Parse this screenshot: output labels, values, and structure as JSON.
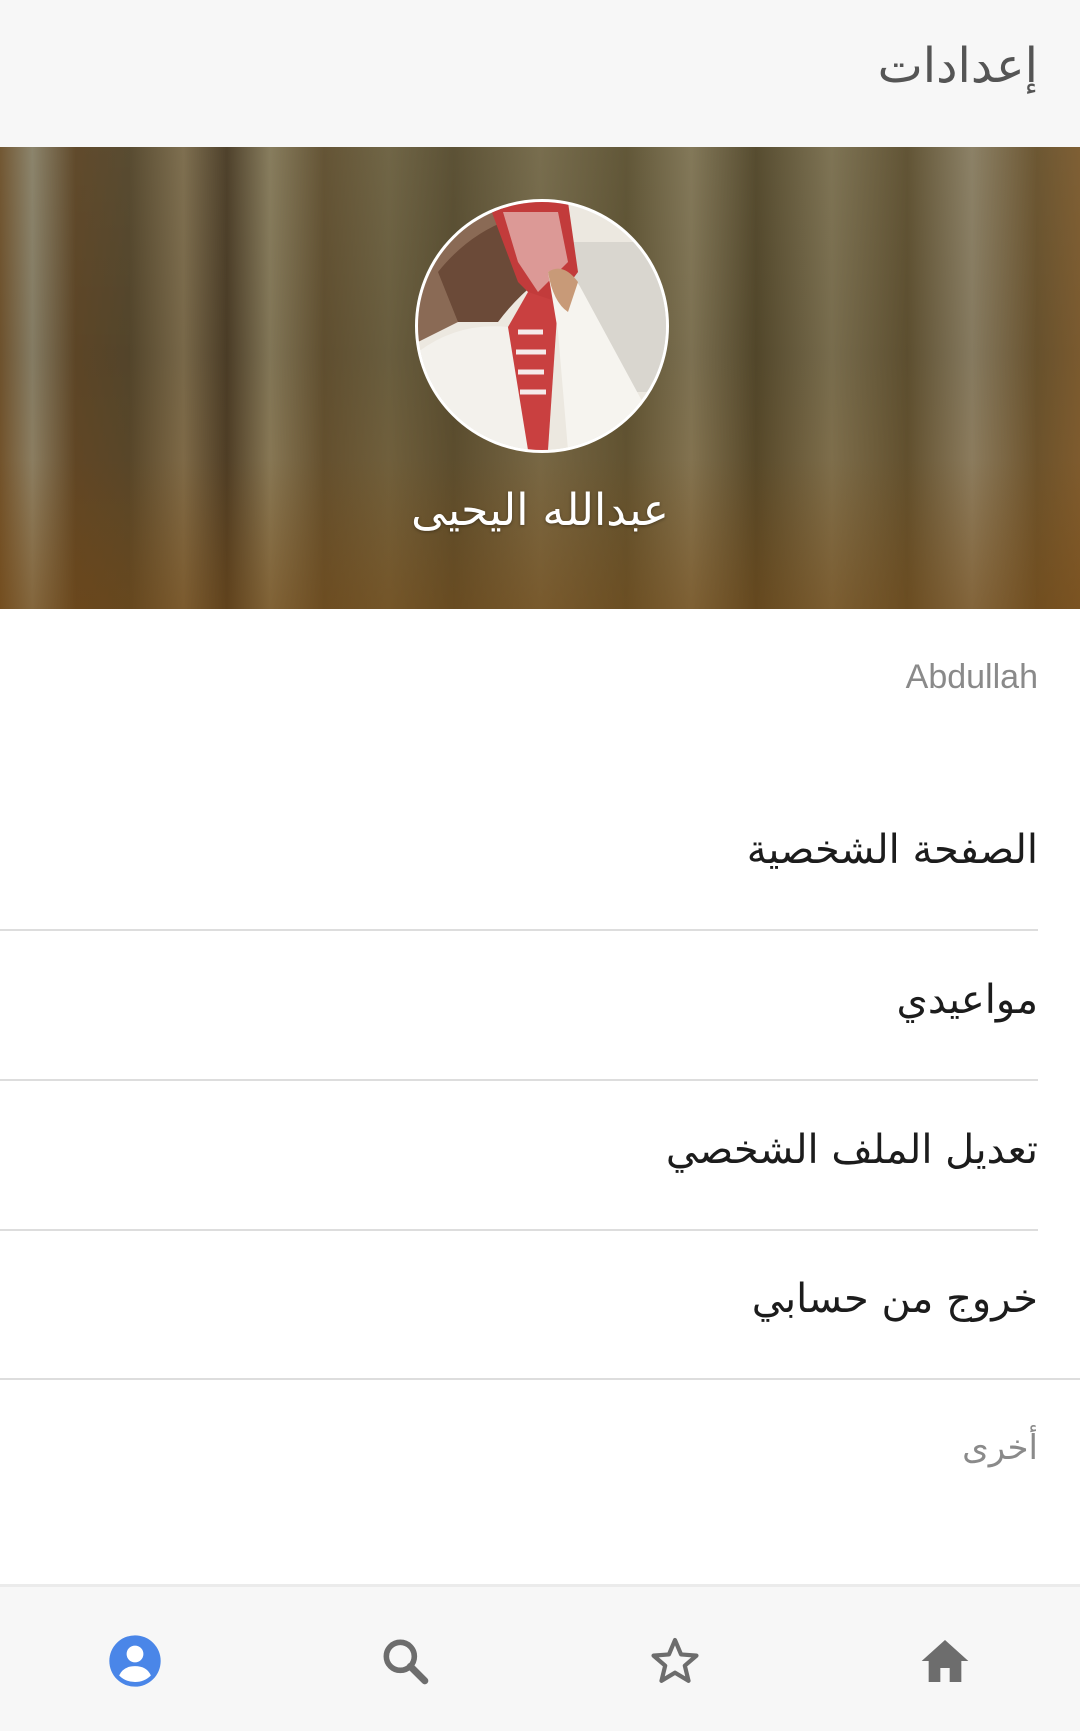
{
  "app_bar": {
    "title": "إعدادات"
  },
  "profile": {
    "display_name": "عبدالله اليحيى",
    "username": "Abdullah"
  },
  "menu": {
    "items": [
      {
        "label": "الصفحة الشخصية"
      },
      {
        "label": "مواعيدي"
      },
      {
        "label": "تعديل الملف الشخصي"
      },
      {
        "label": "خروج من حسابي"
      }
    ]
  },
  "sections": {
    "other_label": "أخرى"
  },
  "bottom_nav": {
    "items": [
      {
        "icon": "account-icon",
        "active": true
      },
      {
        "icon": "search-icon",
        "active": false
      },
      {
        "icon": "star-outline-icon",
        "active": false
      },
      {
        "icon": "home-icon",
        "active": false
      }
    ],
    "active_color": "#4a86e8",
    "inactive_color": "#6d6d6d"
  },
  "colors": {
    "app_bar_bg": "#f7f7f7",
    "divider": "#dddddd",
    "muted_text": "#8a8a8a"
  }
}
